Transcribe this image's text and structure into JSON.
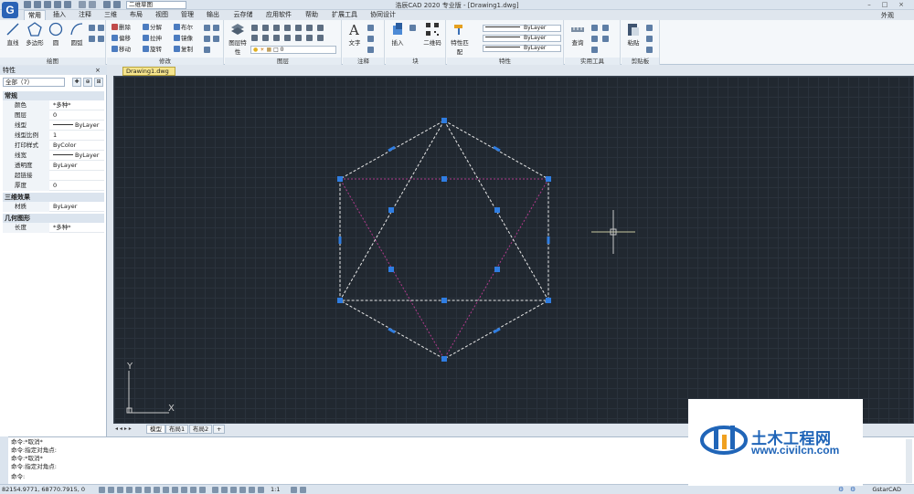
{
  "title": "浩辰CAD 2020 专业版 - [Drawing1.dwg]",
  "app_logo": "G",
  "workspace": "二维草图",
  "window_controls": [
    "–",
    "□",
    "×"
  ],
  "menu_tabs": [
    "常用",
    "插入",
    "注释",
    "三维",
    "布局",
    "视图",
    "管理",
    "输出",
    "云存储",
    "应用软件",
    "帮助",
    "扩展工具",
    "协同设计"
  ],
  "appearance_label": "外观",
  "ribbon": {
    "draw": {
      "label": "绘图",
      "buttons": [
        "直线",
        "多边形",
        "圆",
        "圆弧"
      ]
    },
    "modify": {
      "label": "修改",
      "col1": [
        "删除",
        "偏移",
        "移动"
      ],
      "col2": [
        "分解",
        "拉抻",
        "旋转"
      ],
      "col3": [
        "布尔",
        "镜像",
        "复制"
      ]
    },
    "layers": {
      "label": "图层",
      "button": "图层特性",
      "layer_value": "0"
    },
    "annotation": {
      "label": "注释",
      "button": "文字"
    },
    "block": {
      "label": "块",
      "buttons": [
        "插入",
        "二维码"
      ]
    },
    "properties": {
      "label": "特性",
      "button": "特性匹配",
      "selects": [
        "ByLayer",
        "ByLayer",
        "ByLayer"
      ]
    },
    "utilities": {
      "label": "实用工具",
      "button": "查询"
    },
    "clipboard": {
      "label": "剪贴板",
      "button": "粘贴"
    }
  },
  "doc_tab": "Drawing1.dwg",
  "properties_panel": {
    "title": "特性",
    "selection": "全部（7）",
    "sections": [
      {
        "name": "常规",
        "rows": [
          {
            "k": "颜色",
            "v": "*多种*"
          },
          {
            "k": "图层",
            "v": "0"
          },
          {
            "k": "线型",
            "v": "ByLayer"
          },
          {
            "k": "线型比例",
            "v": "1"
          },
          {
            "k": "打印样式",
            "v": "ByColor"
          },
          {
            "k": "线宽",
            "v": "ByLayer"
          },
          {
            "k": "透明度",
            "v": "ByLayer"
          },
          {
            "k": "超链接",
            "v": ""
          },
          {
            "k": "厚度",
            "v": "0"
          }
        ]
      },
      {
        "name": "三维效果",
        "rows": [
          {
            "k": "材质",
            "v": "ByLayer"
          }
        ]
      },
      {
        "name": "几何图形",
        "rows": [
          {
            "k": "长度",
            "v": "*多种*"
          }
        ]
      }
    ]
  },
  "ucs": {
    "x": "X",
    "y": "Y"
  },
  "layout_tabs": [
    "模型",
    "布局1",
    "布局2",
    "+"
  ],
  "command_lines": [
    "命令:*取消*",
    "命令:指定对角点:",
    "命令:*取消*",
    "命令:指定对角点:",
    "命令:"
  ],
  "status": {
    "coords": "82154.9771, 68770.7915, 0",
    "scale": "1:1",
    "brand": "GstarCAD"
  },
  "watermark": {
    "title": "土木工程网",
    "url": "www.civilcn.com"
  },
  "colors": {
    "canvas_bg": "#212830",
    "grip": "#2f7de1",
    "dashed": "#e8e8e8",
    "magenta": "#b03a8c",
    "crosshair": "#c8c8c8"
  }
}
